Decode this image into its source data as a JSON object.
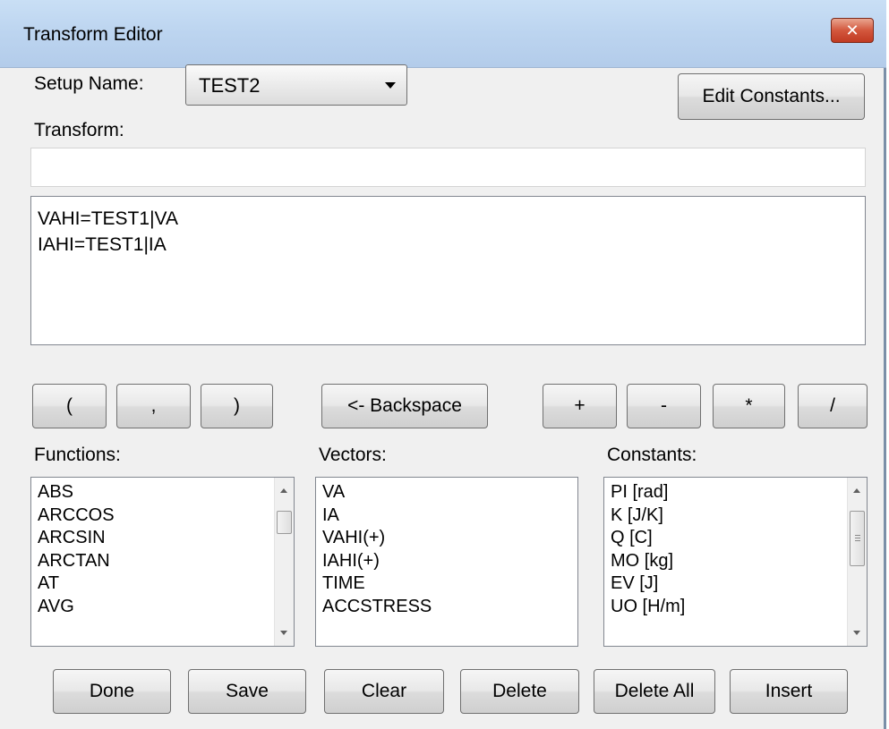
{
  "window": {
    "title": "Transform Editor",
    "close_glyph": "✕"
  },
  "setup": {
    "label": "Setup Name:",
    "selected": "TEST2"
  },
  "edit_constants_label": "Edit Constants...",
  "transform": {
    "label": "Transform:",
    "input_value": "",
    "lines": [
      "VAHI=TEST1|VA",
      "IAHI=TEST1|IA"
    ]
  },
  "keypad": {
    "open_paren": "(",
    "comma": ",",
    "close_paren": ")",
    "backspace": "<- Backspace",
    "plus": "+",
    "minus": "-",
    "multiply": "*",
    "divide": "/"
  },
  "functions": {
    "label": "Functions:",
    "items": [
      "ABS",
      "ARCCOS",
      "ARCSIN",
      "ARCTAN",
      "AT",
      "AVG"
    ]
  },
  "vectors": {
    "label": "Vectors:",
    "items": [
      "VA",
      "IA",
      "VAHI(+)",
      "IAHI(+)",
      "TIME",
      "ACCSTRESS"
    ]
  },
  "constants": {
    "label": "Constants:",
    "items": [
      "PI  [rad]",
      "K  [J/K]",
      "Q  [C]",
      "MO  [kg]",
      "EV  [J]",
      "UO  [H/m]"
    ]
  },
  "actions": {
    "done": "Done",
    "save": "Save",
    "clear": "Clear",
    "delete": "Delete",
    "delete_all": "Delete All",
    "insert": "Insert"
  },
  "icons": {
    "close": "close-icon",
    "dropdown": "chevron-down-icon",
    "scroll_up": "scroll-up-arrow-icon",
    "scroll_down": "scroll-down-arrow-icon"
  }
}
